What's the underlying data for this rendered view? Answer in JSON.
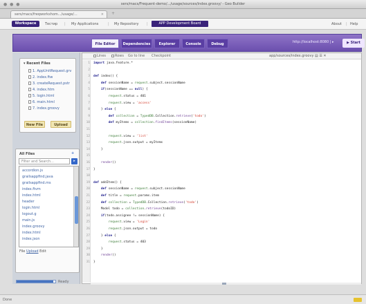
{
  "window": {
    "controls": "● ● ●",
    "title": "sers/macs/Frequent-demo/.../usage/sources/index.groovy/ - Geo Builder"
  },
  "browser_tabs": [
    {
      "label": "sers/macs/freqworkshom.../usage/..."
    }
  ],
  "appbar": {
    "logo": "Workspace",
    "links": [
      "Тестир",
      "My Applications",
      "My Repository"
    ],
    "highlighted": "APP Development Board",
    "right_links": [
      "About",
      "Help"
    ]
  },
  "toolbar": {
    "tabs": [
      {
        "label": "File Editor",
        "active": true
      },
      {
        "label": "Dependencies",
        "active": false
      },
      {
        "label": "Explorer",
        "active": false
      },
      {
        "label": "Console",
        "active": false
      },
      {
        "label": "Debug",
        "active": false
      }
    ],
    "url": "http://localhost:8080 | ▸",
    "start": "▶ Start"
  },
  "recent_files": {
    "title": "▾ Recent Files",
    "items": [
      "1. AppUnitRequest.grv",
      "2. index.ftw",
      "3. createRequest.pstr",
      "4. index.htm",
      "5. login.html",
      "6. main.html",
      "7. index.groovy"
    ],
    "buttons": [
      "New File",
      "Upload"
    ]
  },
  "all_files": {
    "title": "All Files",
    "filter_placeholder": "Filter and Search...",
    "filter_button": "▸",
    "items": [
      "accordion.js",
      "grailsappfind.java",
      "grailsappfind.ms",
      "index.ftvm",
      "index.html",
      "header",
      "login.html",
      "logout.g",
      "main.js",
      "index.groovy",
      "index.html",
      "index.json"
    ],
    "footer": [
      "File",
      "Upload",
      "Edit"
    ],
    "add_icon": "+"
  },
  "side_progress": {
    "fill": 0.95,
    "label": "Ready"
  },
  "editor": {
    "toolbar_items": [
      "Lines",
      "Rows",
      "Go to line",
      "Checkpoint"
    ],
    "path": "app/sources/index.groovy ▤ ☰ ✕",
    "lines": [
      {
        "n": "1",
        "text": "import java.feature.*"
      },
      {
        "n": "2",
        "text": ""
      },
      {
        "n": "3",
        "text": "def index() {"
      },
      {
        "n": "4",
        "text": "    def sessionName = request.subject.sessionName"
      },
      {
        "n": "5",
        "text": "    if(sessionName == null) {"
      },
      {
        "n": "6",
        "text": "        request.status = 401"
      },
      {
        "n": "7",
        "text": "        request.view = 'access'"
      },
      {
        "n": "8",
        "text": "    } else {"
      },
      {
        "n": "9",
        "text": "        def collection = TypedDB.Collection.retrieve('todo')"
      },
      {
        "n": "10",
        "text": "        def myItems = collection.findItems(sessionName)"
      },
      {
        "n": "11",
        "text": ""
      },
      {
        "n": "12",
        "text": "        request.view = 'list'"
      },
      {
        "n": "13",
        "text": "        request.json.output = myItems"
      },
      {
        "n": "14",
        "text": "    }"
      },
      {
        "n": "15",
        "text": ""
      },
      {
        "n": "16",
        "text": "    render()"
      },
      {
        "n": "17",
        "text": "}"
      },
      {
        "n": "18",
        "text": ""
      },
      {
        "n": "19",
        "text": "def addItem() {"
      },
      {
        "n": "20",
        "text": "    def sessionName = request.subject.sessionName"
      },
      {
        "n": "21",
        "text": "    def title = request.params.item"
      },
      {
        "n": "22",
        "text": "    def collection = TypedDB.Collection.retrieve('todo')"
      },
      {
        "n": "23",
        "text": "    Model todo = collection.retrieve(todoID)"
      },
      {
        "n": "24",
        "text": "    if(todo.assignee != sessionName) {"
      },
      {
        "n": "25",
        "text": "        request.view = 'Login'"
      },
      {
        "n": "26",
        "text": "        request.json.output = todo"
      },
      {
        "n": "27",
        "text": "    } else {"
      },
      {
        "n": "28",
        "text": "        request.status = 403"
      },
      {
        "n": "29",
        "text": "    }"
      },
      {
        "n": "30",
        "text": "    render()"
      },
      {
        "n": "31",
        "text": "}"
      }
    ]
  },
  "statusbar": {
    "left": "Done"
  }
}
